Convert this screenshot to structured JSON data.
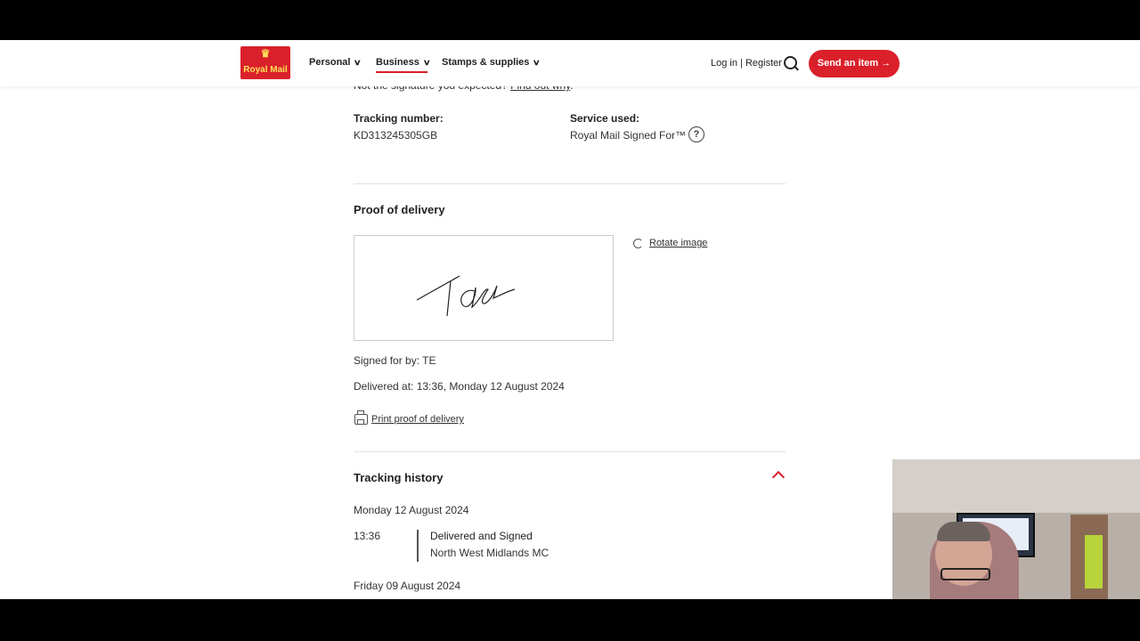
{
  "header": {
    "logo_text": "Royal Mail",
    "nav": [
      {
        "label": "Personal"
      },
      {
        "label": "Business"
      },
      {
        "label": "Stamps & supplies"
      }
    ],
    "login_label": "Log in | Register",
    "send_button_label": "Send an item →"
  },
  "signature_notice": {
    "text": "Not the signature you expected?",
    "link": "Find out why"
  },
  "tracking": {
    "number_label": "Tracking number:",
    "number_value": "KD313245305GB",
    "service_label": "Service used:",
    "service_value": "Royal Mail Signed For™"
  },
  "proof": {
    "heading": "Proof of delivery",
    "rotate_label": "Rotate image",
    "signed_for": "Signed for by: TE",
    "delivered_at": "Delivered at: 13:36, Monday 12 August 2024",
    "print_label": "Print proof of delivery"
  },
  "history": {
    "heading": "Tracking history",
    "groups": [
      {
        "date": "Monday 12 August 2024",
        "events": [
          {
            "time": "13:36",
            "status": "Delivered and Signed",
            "location": "North West Midlands MC"
          }
        ]
      },
      {
        "date": "Friday 09 August 2024",
        "events": []
      }
    ]
  },
  "colors": {
    "brand_red": "#da202a",
    "text": "#333333",
    "divider": "#e3e3e3"
  }
}
